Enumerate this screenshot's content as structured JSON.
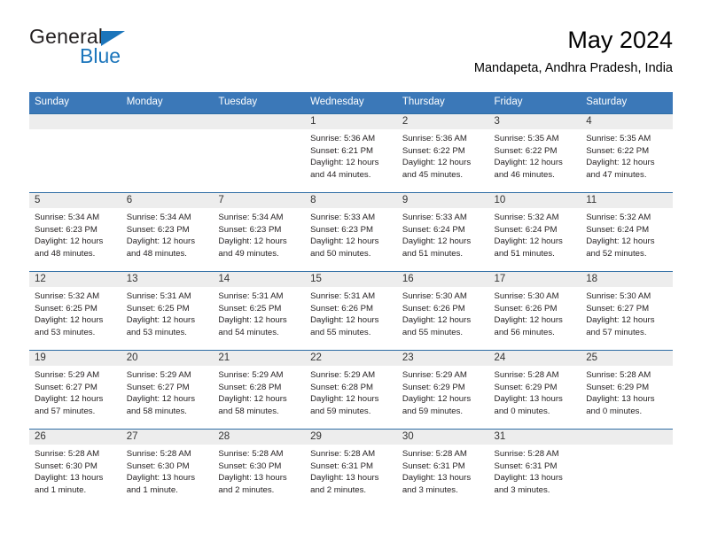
{
  "brand": {
    "name_part1": "General",
    "name_part2": "Blue",
    "triangle_color": "#1b75bb"
  },
  "header": {
    "title": "May 2024",
    "subtitle": "Mandapeta, Andhra Pradesh, India"
  },
  "theme": {
    "header_blue": "#3b78b8",
    "row_divider_blue": "#2e6da4",
    "day_band_grey": "#ededed",
    "text_color": "#231f20"
  },
  "weekdays": [
    "Sunday",
    "Monday",
    "Tuesday",
    "Wednesday",
    "Thursday",
    "Friday",
    "Saturday"
  ],
  "weeks": [
    [
      {
        "day": "",
        "empty": true,
        "sunrise": "",
        "sunset": "",
        "daylight_line1": "",
        "daylight_line2": ""
      },
      {
        "day": "",
        "empty": true,
        "sunrise": "",
        "sunset": "",
        "daylight_line1": "",
        "daylight_line2": ""
      },
      {
        "day": "",
        "empty": true,
        "sunrise": "",
        "sunset": "",
        "daylight_line1": "",
        "daylight_line2": ""
      },
      {
        "day": "1",
        "empty": false,
        "sunrise": "Sunrise: 5:36 AM",
        "sunset": "Sunset: 6:21 PM",
        "daylight_line1": "Daylight: 12 hours",
        "daylight_line2": "and 44 minutes."
      },
      {
        "day": "2",
        "empty": false,
        "sunrise": "Sunrise: 5:36 AM",
        "sunset": "Sunset: 6:22 PM",
        "daylight_line1": "Daylight: 12 hours",
        "daylight_line2": "and 45 minutes."
      },
      {
        "day": "3",
        "empty": false,
        "sunrise": "Sunrise: 5:35 AM",
        "sunset": "Sunset: 6:22 PM",
        "daylight_line1": "Daylight: 12 hours",
        "daylight_line2": "and 46 minutes."
      },
      {
        "day": "4",
        "empty": false,
        "sunrise": "Sunrise: 5:35 AM",
        "sunset": "Sunset: 6:22 PM",
        "daylight_line1": "Daylight: 12 hours",
        "daylight_line2": "and 47 minutes."
      }
    ],
    [
      {
        "day": "5",
        "empty": false,
        "sunrise": "Sunrise: 5:34 AM",
        "sunset": "Sunset: 6:23 PM",
        "daylight_line1": "Daylight: 12 hours",
        "daylight_line2": "and 48 minutes."
      },
      {
        "day": "6",
        "empty": false,
        "sunrise": "Sunrise: 5:34 AM",
        "sunset": "Sunset: 6:23 PM",
        "daylight_line1": "Daylight: 12 hours",
        "daylight_line2": "and 48 minutes."
      },
      {
        "day": "7",
        "empty": false,
        "sunrise": "Sunrise: 5:34 AM",
        "sunset": "Sunset: 6:23 PM",
        "daylight_line1": "Daylight: 12 hours",
        "daylight_line2": "and 49 minutes."
      },
      {
        "day": "8",
        "empty": false,
        "sunrise": "Sunrise: 5:33 AM",
        "sunset": "Sunset: 6:23 PM",
        "daylight_line1": "Daylight: 12 hours",
        "daylight_line2": "and 50 minutes."
      },
      {
        "day": "9",
        "empty": false,
        "sunrise": "Sunrise: 5:33 AM",
        "sunset": "Sunset: 6:24 PM",
        "daylight_line1": "Daylight: 12 hours",
        "daylight_line2": "and 51 minutes."
      },
      {
        "day": "10",
        "empty": false,
        "sunrise": "Sunrise: 5:32 AM",
        "sunset": "Sunset: 6:24 PM",
        "daylight_line1": "Daylight: 12 hours",
        "daylight_line2": "and 51 minutes."
      },
      {
        "day": "11",
        "empty": false,
        "sunrise": "Sunrise: 5:32 AM",
        "sunset": "Sunset: 6:24 PM",
        "daylight_line1": "Daylight: 12 hours",
        "daylight_line2": "and 52 minutes."
      }
    ],
    [
      {
        "day": "12",
        "empty": false,
        "sunrise": "Sunrise: 5:32 AM",
        "sunset": "Sunset: 6:25 PM",
        "daylight_line1": "Daylight: 12 hours",
        "daylight_line2": "and 53 minutes."
      },
      {
        "day": "13",
        "empty": false,
        "sunrise": "Sunrise: 5:31 AM",
        "sunset": "Sunset: 6:25 PM",
        "daylight_line1": "Daylight: 12 hours",
        "daylight_line2": "and 53 minutes."
      },
      {
        "day": "14",
        "empty": false,
        "sunrise": "Sunrise: 5:31 AM",
        "sunset": "Sunset: 6:25 PM",
        "daylight_line1": "Daylight: 12 hours",
        "daylight_line2": "and 54 minutes."
      },
      {
        "day": "15",
        "empty": false,
        "sunrise": "Sunrise: 5:31 AM",
        "sunset": "Sunset: 6:26 PM",
        "daylight_line1": "Daylight: 12 hours",
        "daylight_line2": "and 55 minutes."
      },
      {
        "day": "16",
        "empty": false,
        "sunrise": "Sunrise: 5:30 AM",
        "sunset": "Sunset: 6:26 PM",
        "daylight_line1": "Daylight: 12 hours",
        "daylight_line2": "and 55 minutes."
      },
      {
        "day": "17",
        "empty": false,
        "sunrise": "Sunrise: 5:30 AM",
        "sunset": "Sunset: 6:26 PM",
        "daylight_line1": "Daylight: 12 hours",
        "daylight_line2": "and 56 minutes."
      },
      {
        "day": "18",
        "empty": false,
        "sunrise": "Sunrise: 5:30 AM",
        "sunset": "Sunset: 6:27 PM",
        "daylight_line1": "Daylight: 12 hours",
        "daylight_line2": "and 57 minutes."
      }
    ],
    [
      {
        "day": "19",
        "empty": false,
        "sunrise": "Sunrise: 5:29 AM",
        "sunset": "Sunset: 6:27 PM",
        "daylight_line1": "Daylight: 12 hours",
        "daylight_line2": "and 57 minutes."
      },
      {
        "day": "20",
        "empty": false,
        "sunrise": "Sunrise: 5:29 AM",
        "sunset": "Sunset: 6:27 PM",
        "daylight_line1": "Daylight: 12 hours",
        "daylight_line2": "and 58 minutes."
      },
      {
        "day": "21",
        "empty": false,
        "sunrise": "Sunrise: 5:29 AM",
        "sunset": "Sunset: 6:28 PM",
        "daylight_line1": "Daylight: 12 hours",
        "daylight_line2": "and 58 minutes."
      },
      {
        "day": "22",
        "empty": false,
        "sunrise": "Sunrise: 5:29 AM",
        "sunset": "Sunset: 6:28 PM",
        "daylight_line1": "Daylight: 12 hours",
        "daylight_line2": "and 59 minutes."
      },
      {
        "day": "23",
        "empty": false,
        "sunrise": "Sunrise: 5:29 AM",
        "sunset": "Sunset: 6:29 PM",
        "daylight_line1": "Daylight: 12 hours",
        "daylight_line2": "and 59 minutes."
      },
      {
        "day": "24",
        "empty": false,
        "sunrise": "Sunrise: 5:28 AM",
        "sunset": "Sunset: 6:29 PM",
        "daylight_line1": "Daylight: 13 hours",
        "daylight_line2": "and 0 minutes."
      },
      {
        "day": "25",
        "empty": false,
        "sunrise": "Sunrise: 5:28 AM",
        "sunset": "Sunset: 6:29 PM",
        "daylight_line1": "Daylight: 13 hours",
        "daylight_line2": "and 0 minutes."
      }
    ],
    [
      {
        "day": "26",
        "empty": false,
        "sunrise": "Sunrise: 5:28 AM",
        "sunset": "Sunset: 6:30 PM",
        "daylight_line1": "Daylight: 13 hours",
        "daylight_line2": "and 1 minute."
      },
      {
        "day": "27",
        "empty": false,
        "sunrise": "Sunrise: 5:28 AM",
        "sunset": "Sunset: 6:30 PM",
        "daylight_line1": "Daylight: 13 hours",
        "daylight_line2": "and 1 minute."
      },
      {
        "day": "28",
        "empty": false,
        "sunrise": "Sunrise: 5:28 AM",
        "sunset": "Sunset: 6:30 PM",
        "daylight_line1": "Daylight: 13 hours",
        "daylight_line2": "and 2 minutes."
      },
      {
        "day": "29",
        "empty": false,
        "sunrise": "Sunrise: 5:28 AM",
        "sunset": "Sunset: 6:31 PM",
        "daylight_line1": "Daylight: 13 hours",
        "daylight_line2": "and 2 minutes."
      },
      {
        "day": "30",
        "empty": false,
        "sunrise": "Sunrise: 5:28 AM",
        "sunset": "Sunset: 6:31 PM",
        "daylight_line1": "Daylight: 13 hours",
        "daylight_line2": "and 3 minutes."
      },
      {
        "day": "31",
        "empty": false,
        "sunrise": "Sunrise: 5:28 AM",
        "sunset": "Sunset: 6:31 PM",
        "daylight_line1": "Daylight: 13 hours",
        "daylight_line2": "and 3 minutes."
      },
      {
        "day": "",
        "empty": true,
        "sunrise": "",
        "sunset": "",
        "daylight_line1": "",
        "daylight_line2": ""
      }
    ]
  ]
}
